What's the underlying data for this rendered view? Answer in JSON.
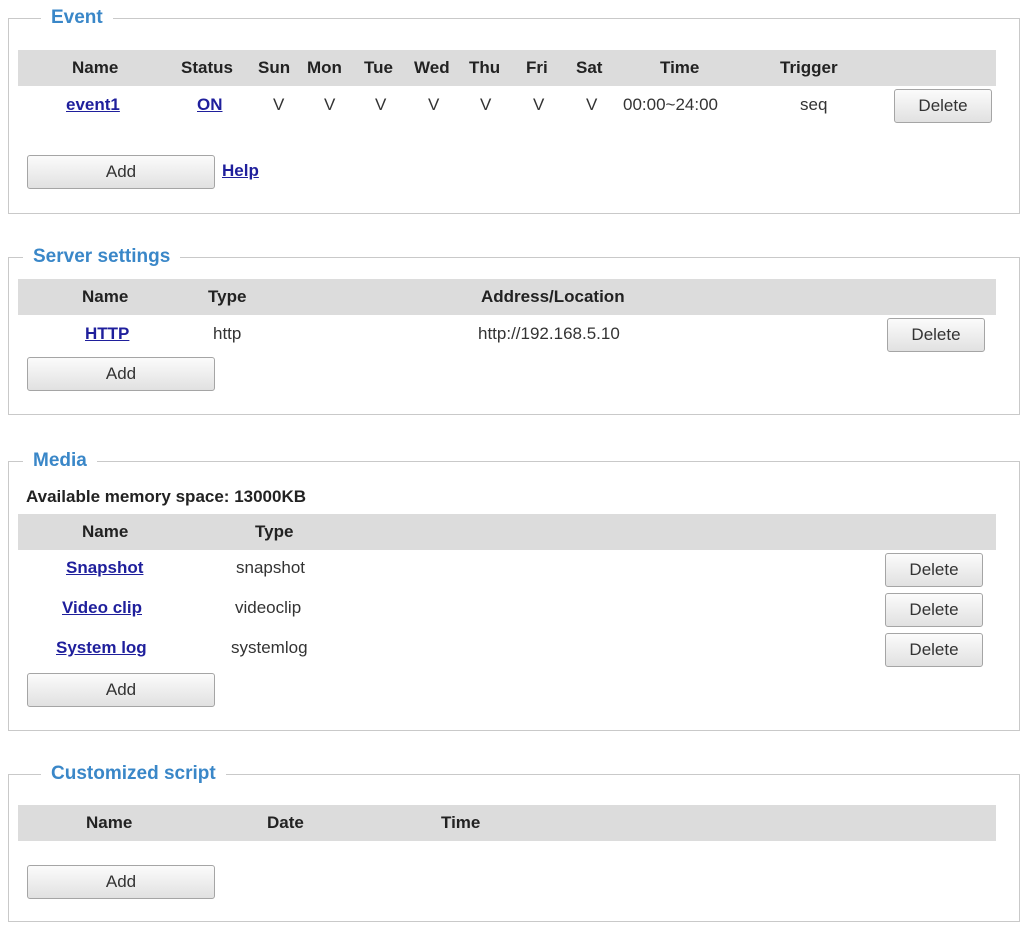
{
  "event": {
    "legend": "Event",
    "headers": [
      "Name",
      "Status",
      "Sun",
      "Mon",
      "Tue",
      "Wed",
      "Thu",
      "Fri",
      "Sat",
      "Time",
      "Trigger"
    ],
    "row": {
      "name": "event1",
      "status": "ON",
      "days": [
        "V",
        "V",
        "V",
        "V",
        "V",
        "V",
        "V"
      ],
      "time": "00:00~24:00",
      "trigger": "seq",
      "delete_label": "Delete"
    },
    "add_label": "Add",
    "help_label": "Help"
  },
  "server": {
    "legend": "Server settings",
    "headers": [
      "Name",
      "Type",
      "Address/Location"
    ],
    "row": {
      "name": "HTTP",
      "type": "http",
      "address": "http://192.168.5.10",
      "delete_label": "Delete"
    },
    "add_label": "Add"
  },
  "media": {
    "legend": "Media",
    "memory_text": "Available memory space: 13000KB",
    "headers": [
      "Name",
      "Type"
    ],
    "rows": [
      {
        "name": "Snapshot",
        "type": "snapshot",
        "delete_label": "Delete"
      },
      {
        "name": "Video clip",
        "type": "videoclip",
        "delete_label": "Delete"
      },
      {
        "name": "System log",
        "type": "systemlog",
        "delete_label": "Delete"
      }
    ],
    "add_label": "Add"
  },
  "script": {
    "legend": "Customized script",
    "headers": [
      "Name",
      "Date",
      "Time"
    ],
    "add_label": "Add"
  }
}
